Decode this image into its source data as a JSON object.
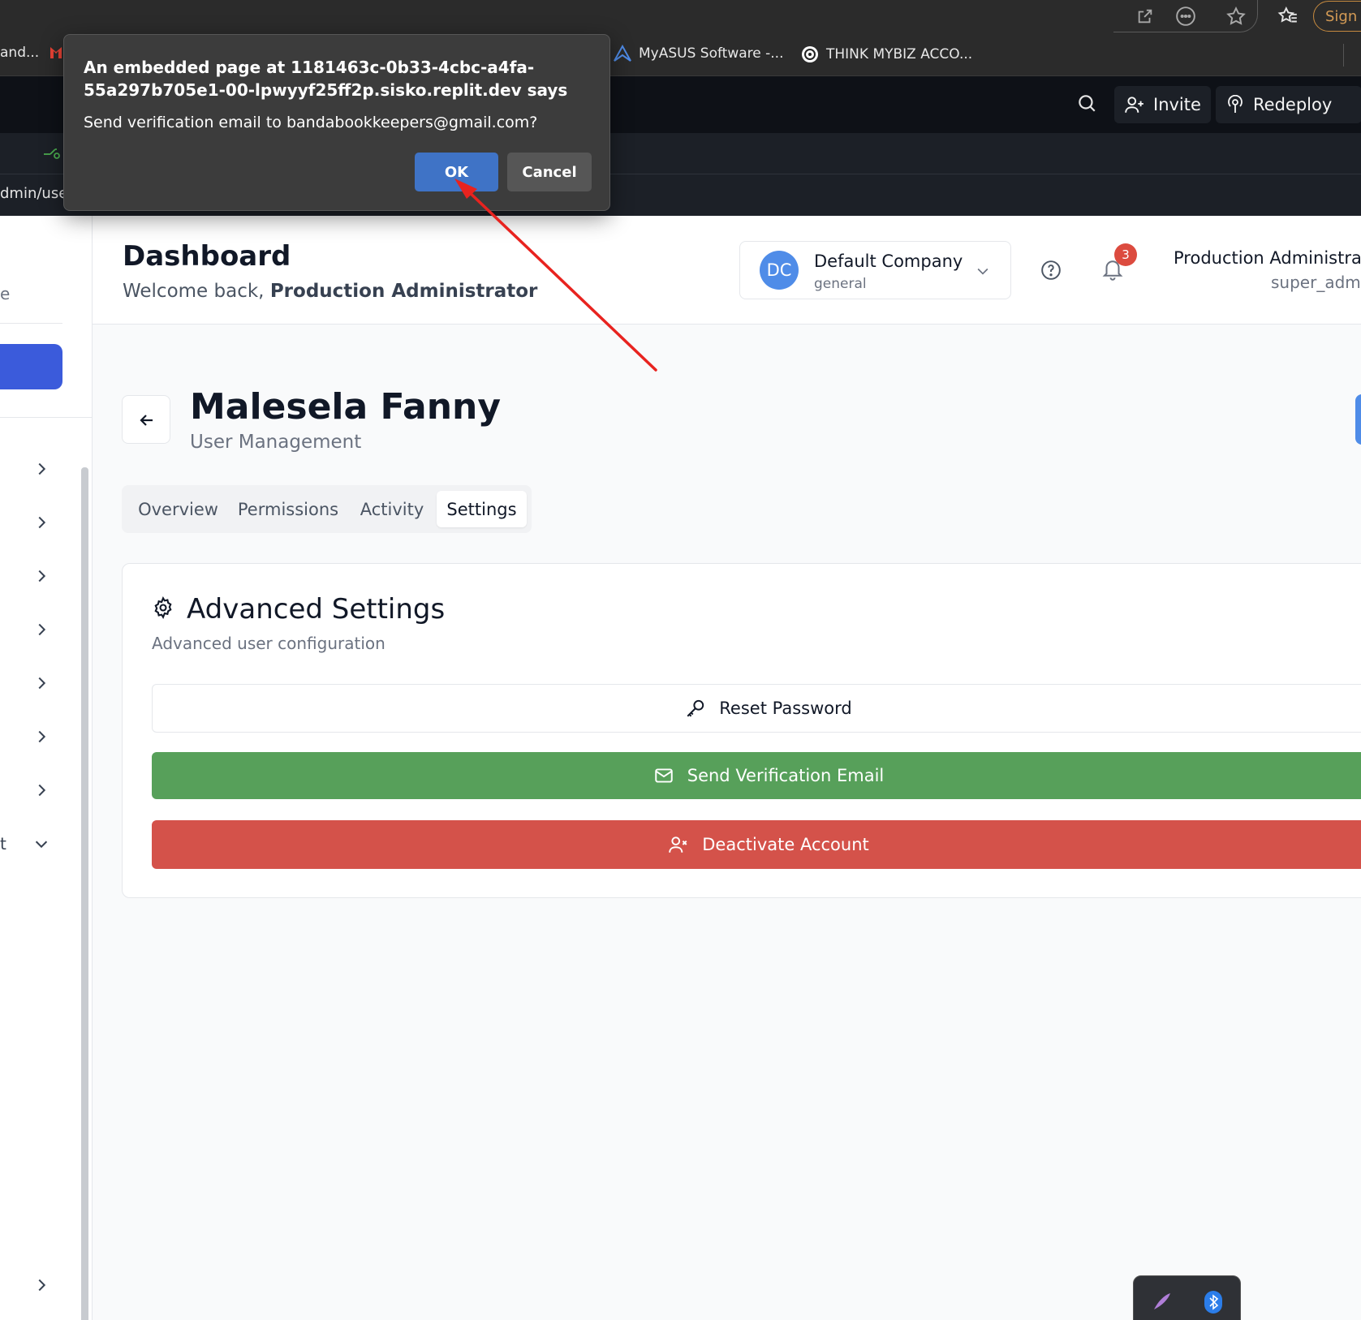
{
  "browser": {
    "sign_in_label": "Sign i",
    "bookmarks": [
      {
        "label": "and..."
      },
      {
        "label": "MyASUS Software -..."
      },
      {
        "label": "THINK MYBIZ ACCO..."
      }
    ]
  },
  "replit": {
    "invite_label": "Invite",
    "redeploy_label": "Redeploy",
    "url_fragment": "dmin/user"
  },
  "sidebar": {
    "fragment_e": "e",
    "fragment_t": "t"
  },
  "header": {
    "title": "Dashboard",
    "welcome_prefix": "Welcome back, ",
    "welcome_name": "Production Administrator",
    "company_initials": "DC",
    "company_name": "Default Company",
    "company_type": "general",
    "notification_count": "3",
    "user_name": "Production Administrato",
    "user_role": "super_admi"
  },
  "page": {
    "user_name": "Malesela Fanny",
    "subtitle": "User Management",
    "tabs": [
      {
        "label": "Overview",
        "active": false
      },
      {
        "label": "Permissions",
        "active": false
      },
      {
        "label": "Activity",
        "active": false
      },
      {
        "label": "Settings",
        "active": true
      }
    ]
  },
  "settings_card": {
    "title": "Advanced Settings",
    "subtitle": "Advanced user configuration",
    "reset_label": "Reset Password",
    "verify_label": "Send Verification Email",
    "deactivate_label": "Deactivate Account"
  },
  "dialog": {
    "title": "An embedded page at 1181463c-0b33-4cbc-a4fa-55a297b705e1-00-lpwyyf25ff2p.sisko.replit.dev says",
    "message": "Send verification email to bandabookkeepers@gmail.com?",
    "ok_label": "OK",
    "cancel_label": "Cancel"
  },
  "colors": {
    "primary": "#3b5bdb",
    "success": "#57a05a",
    "danger": "#d4524a",
    "dialog_ok": "#3f73c6",
    "annotation_arrow": "#e8231f"
  }
}
